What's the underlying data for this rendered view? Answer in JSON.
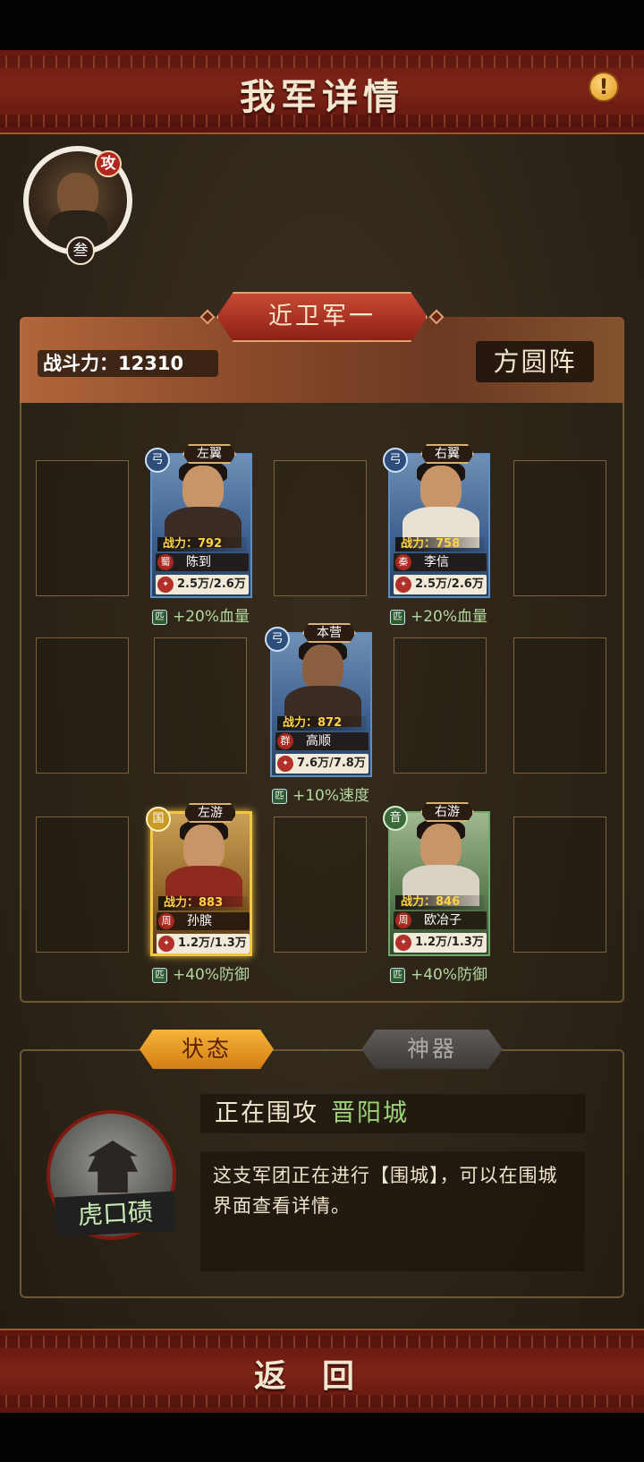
{
  "header": {
    "title": "我军详情",
    "info_icon": "!"
  },
  "commander": {
    "attack_badge": "攻",
    "count_badge": "叁"
  },
  "army": {
    "name": "近卫军一",
    "power": "战斗力：12310",
    "formation": "方圆阵"
  },
  "generals": [
    {
      "position": "左翼",
      "type": "弓",
      "power": "战力：792",
      "faction": "蜀",
      "name": "陈到",
      "troops": "2.5万/2.6万",
      "bonus": "+20%血量",
      "bonus_icon": "匹"
    },
    {
      "position": "右翼",
      "type": "弓",
      "power": "战力：758",
      "faction": "秦",
      "name": "李信",
      "troops": "2.5万/2.6万",
      "bonus": "+20%血量",
      "bonus_icon": "匹"
    },
    {
      "position": "本营",
      "type": "弓",
      "power": "战力：872",
      "faction": "群",
      "name": "高顺",
      "troops": "7.6万/7.8万",
      "bonus": "+10%速度",
      "bonus_icon": "匹"
    },
    {
      "position": "左游",
      "type": "国",
      "power": "战力：883",
      "faction": "周",
      "name": "孙膑",
      "troops": "1.2万/1.3万",
      "bonus": "+40%防御",
      "bonus_icon": "匹"
    },
    {
      "position": "右游",
      "type": "音",
      "power": "战力：846",
      "faction": "周",
      "name": "欧冶子",
      "troops": "1.2万/1.3万",
      "bonus": "+40%防御",
      "bonus_icon": "匹"
    }
  ],
  "tabs": {
    "status": "状态",
    "artifact": "神器"
  },
  "status": {
    "prefix": "正在围攻",
    "target": "晋阳城",
    "city": "虎口碛",
    "description": "这支军团正在进行【围城】，可以在围城界面查看详情。"
  },
  "footer": {
    "back": "返回"
  }
}
